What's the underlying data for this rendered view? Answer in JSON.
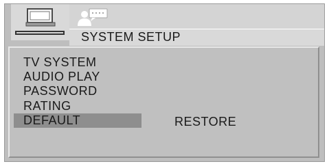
{
  "tabs": [
    {
      "icon": "tv-icon",
      "active": true
    },
    {
      "icon": "person-icon",
      "active": false
    }
  ],
  "header": {
    "title": "SYSTEM SETUP"
  },
  "menu": {
    "items": [
      {
        "label": "TV SYSTEM"
      },
      {
        "label": "AUDIO PLAY"
      },
      {
        "label": "PASSWORD"
      },
      {
        "label": "RATING"
      },
      {
        "label": "DEFAULT",
        "selected": true
      }
    ]
  },
  "option": {
    "label": "RESTORE"
  },
  "colors": {
    "panel": "#bebebe",
    "tab_active": "#d9d9d9",
    "highlight": "#8e8e8e",
    "text": "#1a1a1a"
  }
}
